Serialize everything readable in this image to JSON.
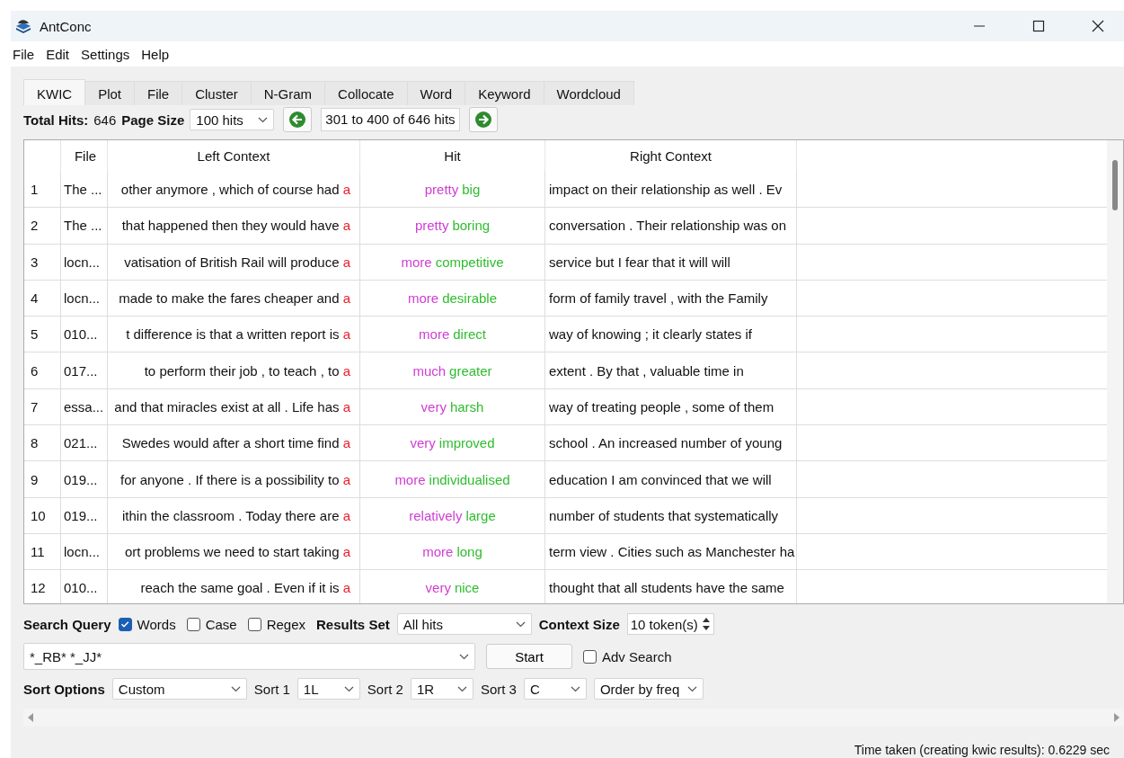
{
  "window": {
    "title": "AntConc"
  },
  "menu": [
    "File",
    "Edit",
    "Settings",
    "Help"
  ],
  "tabs": [
    {
      "label": "KWIC",
      "selected": true
    },
    {
      "label": "Plot",
      "selected": false
    },
    {
      "label": "File",
      "selected": false
    },
    {
      "label": "Cluster",
      "selected": false
    },
    {
      "label": "N-Gram",
      "selected": false
    },
    {
      "label": "Collocate",
      "selected": false
    },
    {
      "label": "Word",
      "selected": false
    },
    {
      "label": "Keyword",
      "selected": false
    },
    {
      "label": "Wordcloud",
      "selected": false
    }
  ],
  "hits_bar": {
    "total_label": "Total Hits:",
    "total": "646",
    "page_size_label": "Page Size",
    "page_size": "100 hits",
    "range": "301 to 400 of 646 hits"
  },
  "table": {
    "columns": [
      "File",
      "Left Context",
      "Hit",
      "Right Context"
    ],
    "rows": [
      {
        "n": "1",
        "file": "The ...",
        "left": "other anymore , which of course had",
        "node": "a",
        "adverb": "pretty",
        "adjective": "big",
        "right": "impact on their relationship as well . Ev"
      },
      {
        "n": "2",
        "file": "The ...",
        "left": "that happened then they would have",
        "node": "a",
        "adverb": "pretty",
        "adjective": "boring",
        "right": "conversation . Their relationship was on"
      },
      {
        "n": "3",
        "file": "locn...",
        "left": "vatisation of British Rail will produce",
        "node": "a",
        "adverb": "more",
        "adjective": "competitive",
        "right": "service but I fear that it will will"
      },
      {
        "n": "4",
        "file": "locn...",
        "left": "made to make the fares cheaper and",
        "node": "a",
        "adverb": "more",
        "adjective": "desirable",
        "right": "form of family travel , with the Family"
      },
      {
        "n": "5",
        "file": "010...",
        "left": "t difference is that a written report is",
        "node": "a",
        "adverb": "more",
        "adjective": "direct",
        "right": "way of knowing ; it clearly states if"
      },
      {
        "n": "6",
        "file": "017...",
        "left": "to perform their job , to teach , to",
        "node": "a",
        "adverb": "much",
        "adjective": "greater",
        "right": "extent . By that , valuable time in"
      },
      {
        "n": "7",
        "file": "essa...",
        "left": "and that miracles exist at all . Life has",
        "node": "a",
        "adverb": "very",
        "adjective": "harsh",
        "right": "way of treating people , some of them"
      },
      {
        "n": "8",
        "file": "021...",
        "left": "Swedes would after a short time find",
        "node": "a",
        "adverb": "very",
        "adjective": "improved",
        "right": "school . An increased number of young"
      },
      {
        "n": "9",
        "file": "019...",
        "left": "for anyone . If there is a possibility to",
        "node": "a",
        "adverb": "more",
        "adjective": "individualised",
        "right": "education I am convinced that we will"
      },
      {
        "n": "10",
        "file": "019...",
        "left": "ithin the classroom . Today there are",
        "node": "a",
        "adverb": "relatively",
        "adjective": "large",
        "right": "number of students that systematically"
      },
      {
        "n": "11",
        "file": "locn...",
        "left": "ort problems we need to start taking",
        "node": "a",
        "adverb": "more",
        "adjective": "long",
        "right": "term view . Cities such as Manchester ha"
      },
      {
        "n": "12",
        "file": "010...",
        "left": "reach the same goal . Even if it is",
        "node": "a",
        "adverb": "very",
        "adjective": "nice",
        "right": "thought that all students have the same"
      }
    ]
  },
  "search": {
    "label": "Search Query",
    "options": [
      {
        "label": "Words",
        "checked": true
      },
      {
        "label": "Case",
        "checked": false
      },
      {
        "label": "Regex",
        "checked": false
      }
    ],
    "results_set_label": "Results Set",
    "results_set": "All hits",
    "context_size_label": "Context Size",
    "context_size": "10 token(s)",
    "query": "*_RB* *_JJ*",
    "start": "Start",
    "adv_search": {
      "label": "Adv Search",
      "checked": false
    }
  },
  "sort": {
    "label": "Sort Options",
    "mode": "Custom",
    "levels": [
      {
        "label": "Sort 1",
        "value": "1L"
      },
      {
        "label": "Sort 2",
        "value": "1R"
      },
      {
        "label": "Sort 3",
        "value": "C"
      }
    ],
    "order": "Order by freq"
  },
  "status_bar": "Time taken (creating kwic results): 0.6229 sec"
}
